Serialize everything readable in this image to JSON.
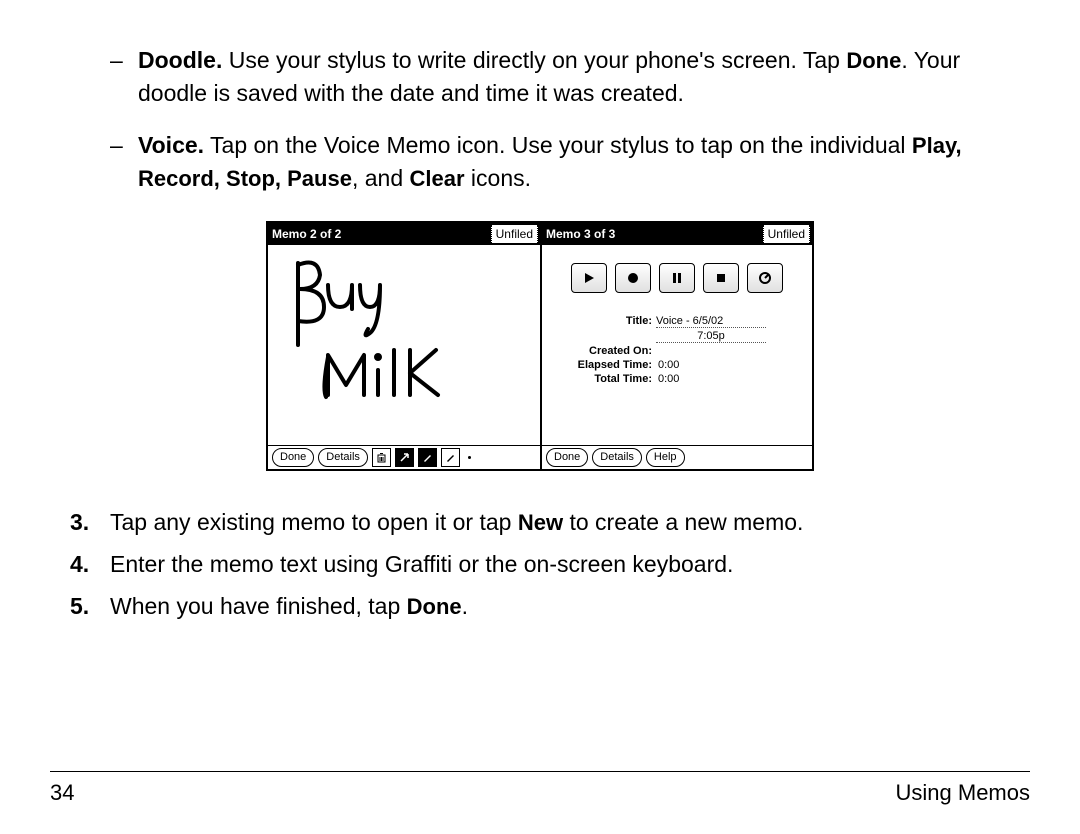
{
  "bullets": {
    "doodle": {
      "lead": "Doodle.",
      "rest_a": " Use your stylus to write directly on your phone's screen. Tap ",
      "done": "Done",
      "rest_b": ". Your doodle is saved with the date and time it was created."
    },
    "voice": {
      "lead": "Voice.",
      "rest_a": " Tap on the Voice Memo icon. Use your stylus to tap on the individual ",
      "controls": "Play, Record, Stop, Pause",
      "comma": ", and ",
      "clear": "Clear",
      "rest_b": " icons."
    }
  },
  "figure": {
    "left": {
      "title": "Memo 2 of 2",
      "category": "Unfiled",
      "handwriting_lines": [
        "Buy",
        "Milk"
      ],
      "toolbar": {
        "done": "Done",
        "details": "Details",
        "icons": [
          "trash-icon",
          "arrow-icon",
          "pen-black-icon",
          "pen-white-icon"
        ]
      }
    },
    "right": {
      "title": "Memo 3 of 3",
      "category": "Unfiled",
      "transport_icons": [
        "play",
        "record",
        "pause",
        "stop",
        "clear"
      ],
      "fields": {
        "title_label": "Title:",
        "title_value_a": "Voice - 6/5/02",
        "title_value_b": "7:05p",
        "created_label": "Created On:",
        "created_value": "",
        "elapsed_label": "Elapsed Time:",
        "elapsed_value": "0:00",
        "total_label": "Total Time:",
        "total_value": "0:00"
      },
      "toolbar": {
        "done": "Done",
        "details": "Details",
        "help": "Help"
      }
    }
  },
  "steps": {
    "s3": {
      "num": "3.",
      "a": "Tap any existing memo to open it or tap ",
      "new": "New",
      "b": " to create a new memo."
    },
    "s4": {
      "num": "4.",
      "a": "Enter the memo text using Graffiti or the on-screen keyboard."
    },
    "s5": {
      "num": "5.",
      "a": "When you have finished, tap ",
      "done": "Done",
      "b": "."
    }
  },
  "footer": {
    "page": "34",
    "section": "Using Memos"
  }
}
